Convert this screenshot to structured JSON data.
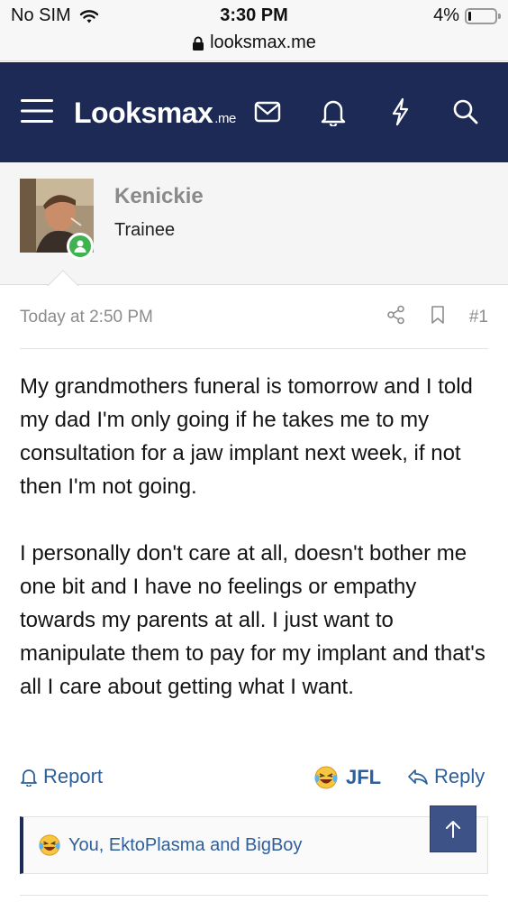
{
  "status_bar": {
    "carrier": "No SIM",
    "time": "3:30 PM",
    "battery": "4%",
    "url": "looksmax.me"
  },
  "header": {
    "logo_main": "Looksmax",
    "logo_suffix": ".me",
    "bg_color": "#1c2a55",
    "icons": [
      "menu-icon",
      "mail-icon",
      "bell-icon",
      "lightning-icon",
      "search-icon"
    ]
  },
  "author": {
    "name": "Kenickie",
    "title": "Trainee",
    "online": true
  },
  "post": {
    "date": "Today at 2:50 PM",
    "number": "#1",
    "paragraphs": [
      "My grandmothers funeral is tomorrow and I told my dad I'm only going if he takes me to my consultation for a jaw implant next week, if not then I'm not going.",
      "I personally don't care at all, doesn't bother me one bit and I have no feelings or empathy towards my parents at all. I just want to manipulate them to pay for my implant and that's all I care about getting what I want."
    ]
  },
  "actions": {
    "report": "Report",
    "reaction": "JFL",
    "reply": "Reply",
    "link_color": "#2d5f9a"
  },
  "reactions_bar": {
    "text": "You, EktoPlasma and BigBoy"
  }
}
